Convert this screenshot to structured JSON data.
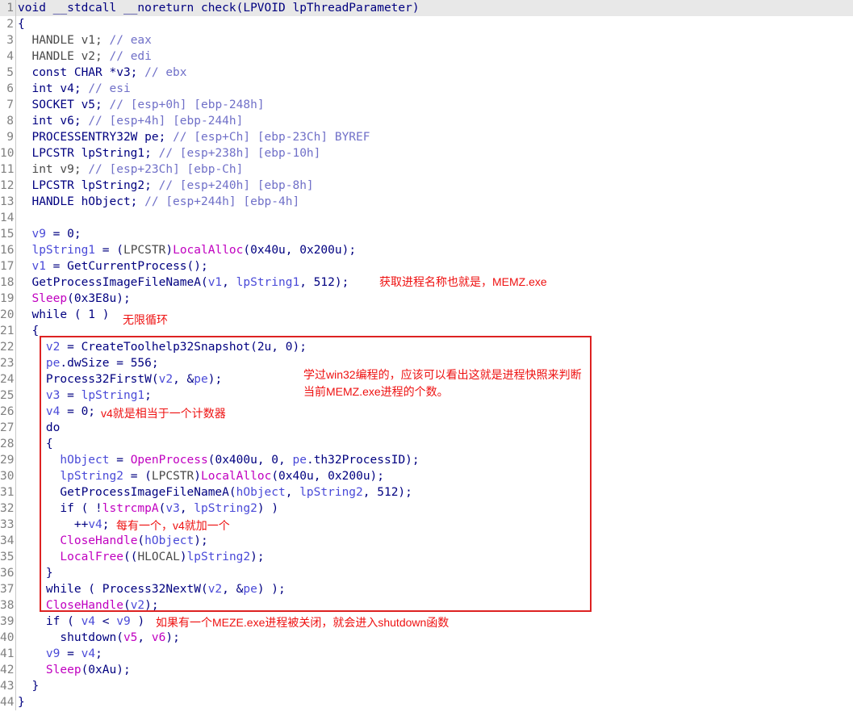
{
  "code_lines": [
    {
      "n": "1",
      "highlight": true,
      "tokens": [
        {
          "t": "void __stdcall __noreturn check(LPVOID lpThreadParameter)",
          "c": "plain"
        }
      ]
    },
    {
      "n": "2",
      "tokens": [
        {
          "t": "{",
          "c": "plain"
        }
      ]
    },
    {
      "n": "3",
      "tokens": [
        {
          "t": "  HANDLE v1; ",
          "c": "cast"
        },
        {
          "t": "// eax",
          "c": "cmt"
        }
      ]
    },
    {
      "n": "4",
      "tokens": [
        {
          "t": "  HANDLE v2; ",
          "c": "cast"
        },
        {
          "t": "// edi",
          "c": "cmt"
        }
      ]
    },
    {
      "n": "5",
      "tokens": [
        {
          "t": "  const CHAR *v3; ",
          "c": "plain"
        },
        {
          "t": "// ebx",
          "c": "cmt"
        }
      ]
    },
    {
      "n": "6",
      "tokens": [
        {
          "t": "  int v4; ",
          "c": "plain"
        },
        {
          "t": "// esi",
          "c": "cmt"
        }
      ]
    },
    {
      "n": "7",
      "tokens": [
        {
          "t": "  SOCKET v5; ",
          "c": "plain"
        },
        {
          "t": "// [esp+0h] [ebp-248h]",
          "c": "cmt"
        }
      ]
    },
    {
      "n": "8",
      "tokens": [
        {
          "t": "  int v6; ",
          "c": "plain"
        },
        {
          "t": "// [esp+4h] [ebp-244h]",
          "c": "cmt"
        }
      ]
    },
    {
      "n": "9",
      "tokens": [
        {
          "t": "  PROCESSENTRY32W pe; ",
          "c": "plain"
        },
        {
          "t": "// [esp+Ch] [ebp-23Ch] BYREF",
          "c": "cmt"
        }
      ]
    },
    {
      "n": "10",
      "tokens": [
        {
          "t": "  LPCSTR lpString1; ",
          "c": "plain"
        },
        {
          "t": "// [esp+238h] [ebp-10h]",
          "c": "cmt"
        }
      ]
    },
    {
      "n": "11",
      "tokens": [
        {
          "t": "  int v9; ",
          "c": "cast"
        },
        {
          "t": "// [esp+23Ch] [ebp-Ch]",
          "c": "cmt"
        }
      ]
    },
    {
      "n": "12",
      "tokens": [
        {
          "t": "  LPCSTR lpString2; ",
          "c": "plain"
        },
        {
          "t": "// [esp+240h] [ebp-8h]",
          "c": "cmt"
        }
      ]
    },
    {
      "n": "13",
      "tokens": [
        {
          "t": "  HANDLE hObject; ",
          "c": "plain"
        },
        {
          "t": "// [esp+244h] [ebp-4h]",
          "c": "cmt"
        }
      ]
    },
    {
      "n": "14",
      "tokens": []
    },
    {
      "n": "15",
      "tokens": [
        {
          "t": "  ",
          "c": "plain"
        },
        {
          "t": "v9",
          "c": "var"
        },
        {
          "t": " = 0;",
          "c": "plain"
        }
      ]
    },
    {
      "n": "16",
      "tokens": [
        {
          "t": "  ",
          "c": "plain"
        },
        {
          "t": "lpString1",
          "c": "var"
        },
        {
          "t": " = (",
          "c": "plain"
        },
        {
          "t": "LPCSTR",
          "c": "cast"
        },
        {
          "t": ")",
          "c": "plain"
        },
        {
          "t": "LocalAlloc",
          "c": "api"
        },
        {
          "t": "(0x40u, 0x200u);",
          "c": "plain"
        }
      ]
    },
    {
      "n": "17",
      "tokens": [
        {
          "t": "  ",
          "c": "plain"
        },
        {
          "t": "v1",
          "c": "var"
        },
        {
          "t": " = GetCurrentProcess();",
          "c": "plain"
        }
      ]
    },
    {
      "n": "18",
      "tokens": [
        {
          "t": "  GetProcessImageFileNameA(",
          "c": "plain"
        },
        {
          "t": "v1",
          "c": "var"
        },
        {
          "t": ", ",
          "c": "plain"
        },
        {
          "t": "lpString1",
          "c": "var"
        },
        {
          "t": ", 512);",
          "c": "plain"
        }
      ]
    },
    {
      "n": "19",
      "tokens": [
        {
          "t": "  ",
          "c": "plain"
        },
        {
          "t": "Sleep",
          "c": "api"
        },
        {
          "t": "(0x3E8u);",
          "c": "plain"
        }
      ]
    },
    {
      "n": "20",
      "tokens": [
        {
          "t": "  while ( 1 )",
          "c": "plain"
        }
      ]
    },
    {
      "n": "21",
      "tokens": [
        {
          "t": "  {",
          "c": "plain"
        }
      ]
    },
    {
      "n": "22",
      "tokens": [
        {
          "t": "    ",
          "c": "plain"
        },
        {
          "t": "v2",
          "c": "var"
        },
        {
          "t": " = CreateToolhelp32Snapshot(2u, 0);",
          "c": "plain"
        }
      ]
    },
    {
      "n": "23",
      "tokens": [
        {
          "t": "    ",
          "c": "plain"
        },
        {
          "t": "pe",
          "c": "var"
        },
        {
          "t": ".dwSize = 556;",
          "c": "plain"
        }
      ]
    },
    {
      "n": "24",
      "tokens": [
        {
          "t": "    Process32FirstW(",
          "c": "plain"
        },
        {
          "t": "v2",
          "c": "var"
        },
        {
          "t": ", &",
          "c": "plain"
        },
        {
          "t": "pe",
          "c": "var"
        },
        {
          "t": ");",
          "c": "plain"
        }
      ]
    },
    {
      "n": "25",
      "tokens": [
        {
          "t": "    ",
          "c": "plain"
        },
        {
          "t": "v3",
          "c": "var"
        },
        {
          "t": " = ",
          "c": "plain"
        },
        {
          "t": "lpString1",
          "c": "var"
        },
        {
          "t": ";",
          "c": "plain"
        }
      ]
    },
    {
      "n": "26",
      "tokens": [
        {
          "t": "    ",
          "c": "plain"
        },
        {
          "t": "v4",
          "c": "var"
        },
        {
          "t": " = 0;",
          "c": "plain"
        }
      ]
    },
    {
      "n": "27",
      "tokens": [
        {
          "t": "    do",
          "c": "plain"
        }
      ]
    },
    {
      "n": "28",
      "tokens": [
        {
          "t": "    {",
          "c": "plain"
        }
      ]
    },
    {
      "n": "29",
      "tokens": [
        {
          "t": "      ",
          "c": "plain"
        },
        {
          "t": "hObject",
          "c": "var"
        },
        {
          "t": " = ",
          "c": "plain"
        },
        {
          "t": "OpenProcess",
          "c": "api"
        },
        {
          "t": "(0x400u, 0, ",
          "c": "plain"
        },
        {
          "t": "pe",
          "c": "var"
        },
        {
          "t": ".th32ProcessID);",
          "c": "plain"
        }
      ]
    },
    {
      "n": "30",
      "tokens": [
        {
          "t": "      ",
          "c": "plain"
        },
        {
          "t": "lpString2",
          "c": "var"
        },
        {
          "t": " = (",
          "c": "plain"
        },
        {
          "t": "LPCSTR",
          "c": "cast"
        },
        {
          "t": ")",
          "c": "plain"
        },
        {
          "t": "LocalAlloc",
          "c": "api"
        },
        {
          "t": "(0x40u, 0x200u);",
          "c": "plain"
        }
      ]
    },
    {
      "n": "31",
      "tokens": [
        {
          "t": "      GetProcessImageFileNameA(",
          "c": "plain"
        },
        {
          "t": "hObject",
          "c": "var"
        },
        {
          "t": ", ",
          "c": "plain"
        },
        {
          "t": "lpString2",
          "c": "var"
        },
        {
          "t": ", 512);",
          "c": "plain"
        }
      ]
    },
    {
      "n": "32",
      "tokens": [
        {
          "t": "      if ( !",
          "c": "plain"
        },
        {
          "t": "lstrcmpA",
          "c": "api"
        },
        {
          "t": "(",
          "c": "plain"
        },
        {
          "t": "v3",
          "c": "var"
        },
        {
          "t": ", ",
          "c": "plain"
        },
        {
          "t": "lpString2",
          "c": "var"
        },
        {
          "t": ") )",
          "c": "plain"
        }
      ]
    },
    {
      "n": "33",
      "tokens": [
        {
          "t": "        ++",
          "c": "plain"
        },
        {
          "t": "v4",
          "c": "var"
        },
        {
          "t": ";",
          "c": "plain"
        }
      ]
    },
    {
      "n": "34",
      "tokens": [
        {
          "t": "      ",
          "c": "plain"
        },
        {
          "t": "CloseHandle",
          "c": "api"
        },
        {
          "t": "(",
          "c": "plain"
        },
        {
          "t": "hObject",
          "c": "var"
        },
        {
          "t": ");",
          "c": "plain"
        }
      ]
    },
    {
      "n": "35",
      "tokens": [
        {
          "t": "      ",
          "c": "plain"
        },
        {
          "t": "LocalFree",
          "c": "api"
        },
        {
          "t": "((",
          "c": "plain"
        },
        {
          "t": "HLOCAL",
          "c": "cast"
        },
        {
          "t": ")",
          "c": "plain"
        },
        {
          "t": "lpString2",
          "c": "var"
        },
        {
          "t": ");",
          "c": "plain"
        }
      ]
    },
    {
      "n": "36",
      "tokens": [
        {
          "t": "    }",
          "c": "plain"
        }
      ]
    },
    {
      "n": "37",
      "tokens": [
        {
          "t": "    while ( Process32NextW(",
          "c": "plain"
        },
        {
          "t": "v2",
          "c": "var"
        },
        {
          "t": ", &",
          "c": "plain"
        },
        {
          "t": "pe",
          "c": "var"
        },
        {
          "t": ") );",
          "c": "plain"
        }
      ]
    },
    {
      "n": "38",
      "tokens": [
        {
          "t": "    ",
          "c": "plain"
        },
        {
          "t": "CloseHandle",
          "c": "api"
        },
        {
          "t": "(",
          "c": "plain"
        },
        {
          "t": "v2",
          "c": "var"
        },
        {
          "t": ");",
          "c": "plain"
        }
      ]
    },
    {
      "n": "39",
      "tokens": [
        {
          "t": "    if ( ",
          "c": "plain"
        },
        {
          "t": "v4",
          "c": "var"
        },
        {
          "t": " < ",
          "c": "plain"
        },
        {
          "t": "v9",
          "c": "var"
        },
        {
          "t": " )",
          "c": "plain"
        }
      ]
    },
    {
      "n": "40",
      "tokens": [
        {
          "t": "      shutdown(",
          "c": "plain"
        },
        {
          "t": "v5",
          "c": "api"
        },
        {
          "t": ", ",
          "c": "plain"
        },
        {
          "t": "v6",
          "c": "api"
        },
        {
          "t": ");",
          "c": "plain"
        }
      ]
    },
    {
      "n": "41",
      "tokens": [
        {
          "t": "    ",
          "c": "plain"
        },
        {
          "t": "v9",
          "c": "var"
        },
        {
          "t": " = ",
          "c": "plain"
        },
        {
          "t": "v4",
          "c": "var"
        },
        {
          "t": ";",
          "c": "plain"
        }
      ]
    },
    {
      "n": "42",
      "tokens": [
        {
          "t": "    ",
          "c": "plain"
        },
        {
          "t": "Sleep",
          "c": "api"
        },
        {
          "t": "(0xAu);",
          "c": "plain"
        }
      ]
    },
    {
      "n": "43",
      "tokens": [
        {
          "t": "  }",
          "c": "plain"
        }
      ]
    },
    {
      "n": "44",
      "tokens": [
        {
          "t": "}",
          "c": "plain"
        }
      ]
    }
  ],
  "annotations": {
    "get_process_name": "获取进程名称也就是，MEMZ.exe",
    "infinite_loop": "无限循环",
    "snapshot_note": "学过win32编程的，应该可以看出这就是进程快照来判断\n当前MEMZ.exe进程的个数。",
    "v4_counter": "v4就是相当于一个计数器",
    "v4_increment": "每有一个，v4就加一个",
    "shutdown_note": "如果有一个MEZE.exe进程被关闭，就会进入shutdown函数"
  },
  "colors": {
    "annotation": "#ee1111",
    "box_border": "#dd2222",
    "code": "#000080",
    "variable": "#4a4ad8",
    "api": "#c000c0",
    "comment": "#7070c8"
  }
}
